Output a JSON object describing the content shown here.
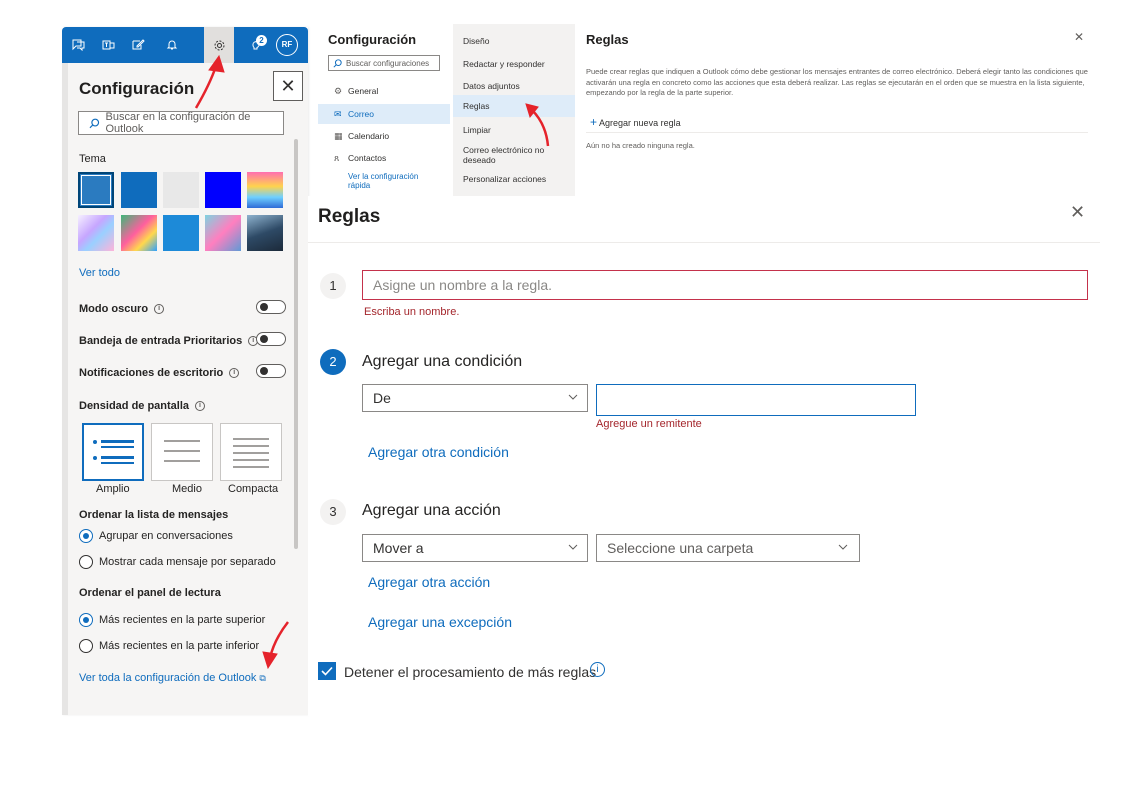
{
  "left_panel": {
    "topbar_badge": "2",
    "avatar_initials": "RF",
    "title": "Configuración",
    "close_label": "✕",
    "search_placeholder": "Buscar en la configuración de Outlook",
    "theme_label": "Tema",
    "see_all": "Ver todo",
    "dark_mode": "Modo oscuro",
    "focused_inbox": "Bandeja de entrada Prioritarios",
    "desktop_notifications": "Notificaciones de escritorio",
    "display_density": "Densidad de pantalla",
    "density_options": [
      "Amplio",
      "Medio",
      "Compacta"
    ],
    "message_list_label": "Ordenar la lista de mensajes",
    "message_list_options": [
      "Agrupar en conversaciones",
      "Mostrar cada mensaje por separado"
    ],
    "reading_pane_label": "Ordenar el panel de lectura",
    "reading_pane_options": [
      "Más recientes en la parte superior",
      "Más recientes en la parte inferior"
    ],
    "all_settings_link": "Ver toda la configuración de Outlook",
    "colors": {
      "blue": "#0f6cbd"
    }
  },
  "config_window": {
    "title": "Configuración",
    "search_placeholder": "Buscar configuraciones",
    "nav": [
      "General",
      "Correo",
      "Calendario",
      "Contactos"
    ],
    "quick_link": "Ver la configuración rápida",
    "mid_items": [
      "Diseño",
      "Redactar y responder",
      "Datos adjuntos",
      "Reglas",
      "Limpiar",
      "Correo electrónico no deseado",
      "Personalizar acciones"
    ],
    "rules_title": "Reglas",
    "rules_description": "Puede crear reglas que indiquen a Outlook cómo debe gestionar los mensajes entrantes de correo electrónico. Deberá elegir tanto las condiciones que activarán una regla en concreto como las acciones que esta deberá realizar. Las reglas se ejecutarán en el orden que se muestra en la lista siguiente, empezando por la regla de la parte superior.",
    "add_rule": "Agregar nueva regla",
    "no_rules": "Aún no ha creado ninguna regla."
  },
  "rules_dialog": {
    "title": "Reglas",
    "step1": "1",
    "name_placeholder": "Asigne un nombre a la regla.",
    "name_error": "Escriba un nombre.",
    "step2": "2",
    "condition_title": "Agregar una condición",
    "condition_select": "De",
    "sender_error": "Agregue un remitente",
    "add_condition": "Agregar otra condición",
    "step3": "3",
    "action_title": "Agregar una acción",
    "action_select": "Mover a",
    "folder_select": "Seleccione una carpeta",
    "add_action": "Agregar otra acción",
    "add_exception": "Agregar una excepción",
    "stop_processing": "Detener el procesamiento de más reglas"
  }
}
